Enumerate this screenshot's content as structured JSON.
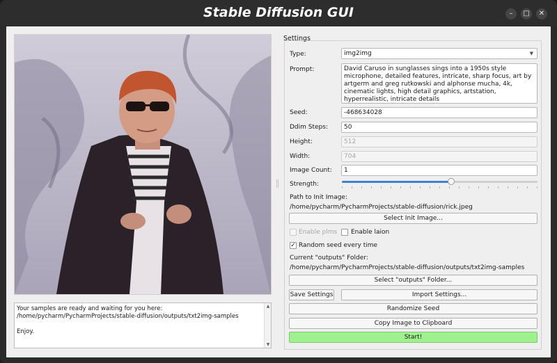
{
  "window": {
    "title": "Stable Diffusion GUI",
    "minimize_icon": "minimize-icon",
    "maximize_icon": "maximize-icon",
    "close_icon": "close-icon"
  },
  "preview": {
    "description_icon": "generated-image"
  },
  "log": {
    "text": "Your samples are ready and waiting for you here:\n/home/pycharm/PycharmProjects/stable-diffusion/outputs/txt2img-samples\n\nEnjoy."
  },
  "settings": {
    "group_title": "Settings",
    "type_label": "Type:",
    "type_value": "img2img",
    "prompt_label": "Prompt:",
    "prompt_value": "David Caruso in sunglasses sings into a 1950s style microphone, detailed features, intricate, sharp focus, art by artgerm and greg rutkowski and alphonse mucha, 4k, cinematic lights, high detail graphics, artstation, hyperrealistic, intricate details",
    "seed_label": "Seed:",
    "seed_value": "-468634028",
    "ddim_label": "Ddim Steps:",
    "ddim_value": "50",
    "height_label": "Height:",
    "height_value": "512",
    "width_label": "Width:",
    "width_value": "704",
    "count_label": "Image Count:",
    "count_value": "1",
    "strength_label": "Strength:",
    "strength_value": 0.56,
    "init_path_label": "Path to Init Image:",
    "init_path_value": "/home/pycharm/PycharmProjects/stable-diffusion/rick.jpeg",
    "select_init_button": "Select Init Image...",
    "enable_plms_label": "Enable plms",
    "enable_laion_label": "Enable laion",
    "random_seed_label": "Random seed every time",
    "outputs_label": "Current \"outputs\" Folder:",
    "outputs_value": "/home/pycharm/PycharmProjects/stable-diffusion/outputs/txt2img-samples",
    "select_outputs_button": "Select \"outputs\" Folder...",
    "save_settings_button": "Save Settings",
    "import_settings_button": "Import Settings...",
    "randomize_seed_button": "Randomize Seed",
    "copy_image_button": "Copy Image to Clipboard",
    "start_button": "Start!"
  },
  "checks": {
    "plms": false,
    "laion": false,
    "random_seed": true
  },
  "colors": {
    "start": "#9ff08f",
    "slider": "#3f83d0"
  }
}
